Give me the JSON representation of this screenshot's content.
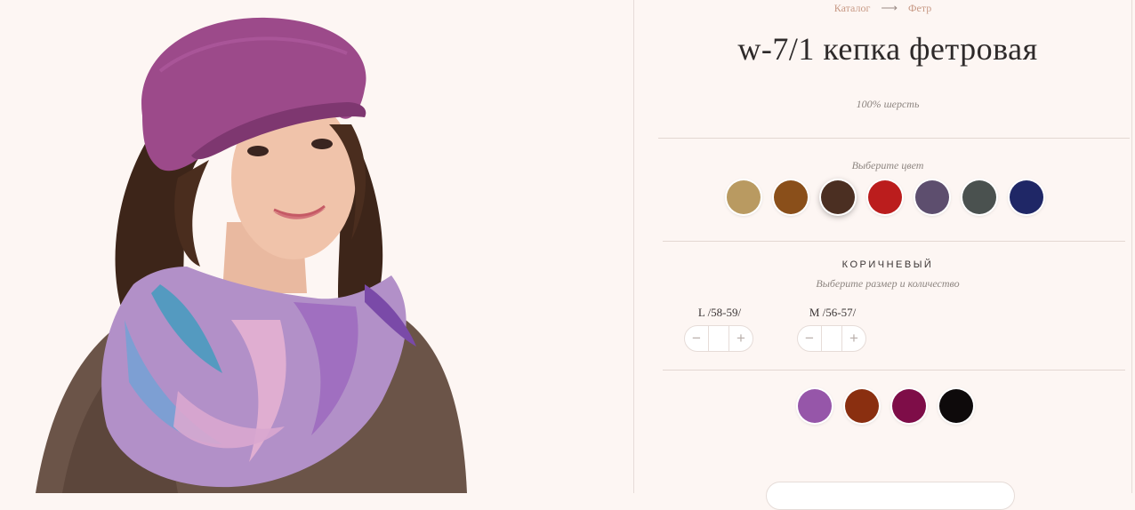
{
  "breadcrumb": {
    "catalog": "Каталог",
    "separator": "⟶",
    "category": "Фетр"
  },
  "product": {
    "title": "w-7/1 кепка фетровая",
    "material": "100% шерсть"
  },
  "colors": {
    "prompt": "Выберите цвет",
    "main_swatches": [
      "#b99a61",
      "#8a4f1a",
      "#4b2f22",
      "#bb1d1d",
      "#5d4e6e",
      "#4a514f",
      "#1f2766"
    ],
    "active_index": 2,
    "selected_name": "КОРИЧНЕВЫЙ",
    "extra_swatches": [
      "#9656a9",
      "#8a2f10",
      "#7e0d48",
      "#0e0a0b"
    ]
  },
  "sizes": {
    "prompt": "Выберите размер и количество",
    "items": [
      {
        "label": "L /58-59/",
        "minus": "−",
        "plus": "+",
        "value": ""
      },
      {
        "label": "M /56-57/",
        "minus": "−",
        "plus": "+",
        "value": ""
      }
    ]
  }
}
